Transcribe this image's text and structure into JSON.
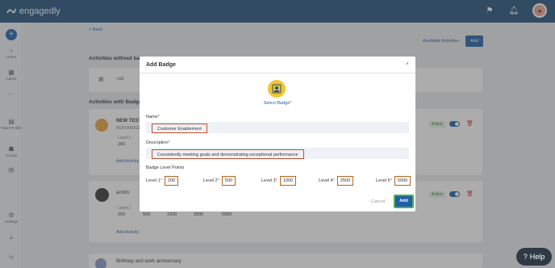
{
  "app": {
    "name": "engagedly"
  },
  "sidebar": {
    "items": [
      {
        "label": "Home",
        "icon": "home-icon"
      },
      {
        "label": "Admin",
        "icon": "admin-icon"
      },
      {
        "label": "Talent Profile",
        "icon": "profile-icon"
      },
      {
        "label": "Groups",
        "icon": "groups-icon"
      },
      {
        "label": "Settings",
        "icon": "settings-icon"
      }
    ]
  },
  "page": {
    "back": "< Back",
    "available": "Available Activities",
    "add": "Add",
    "section1": "Activities without badges",
    "section2": "Activities with Badges",
    "row1_count": "+10",
    "card1": {
      "title": "NEW TEST",
      "sub": "NEW BADGE",
      "level": "Level 1",
      "value": "200",
      "link": "Add Activity",
      "status": "Active"
    },
    "card2": {
      "title": "acvbn",
      "level": "Level 1",
      "values": [
        "200",
        "500",
        "1000",
        "2500",
        "5000"
      ],
      "link": "Add Activity",
      "status": "Active"
    },
    "card3": {
      "title": "Birthday and work anniversary"
    }
  },
  "modal": {
    "title": "Add Badge",
    "close": "×",
    "select_badge": "Select Badge",
    "name_label": "Name",
    "name_value": "Customer Enablement",
    "desc_label": "Description",
    "desc_value": "Consistently meeting goals and demonstrating exceptional performance",
    "levels_label": "Badge Level Points",
    "levels": [
      {
        "label": "Level 1",
        "value": "200"
      },
      {
        "label": "Level 2",
        "value": "500"
      },
      {
        "label": "Level 3",
        "value": "1000"
      },
      {
        "label": "Level 4",
        "value": "2500"
      },
      {
        "label": "Level 5",
        "value": "5000"
      }
    ],
    "cancel": "Cancel",
    "add": "Add"
  },
  "help": {
    "label": "Help"
  },
  "colors": {
    "brand": "#1f4f7b",
    "accent": "#1f5fa8",
    "badge": "#f1c531",
    "highlight": "#c94a2e"
  }
}
